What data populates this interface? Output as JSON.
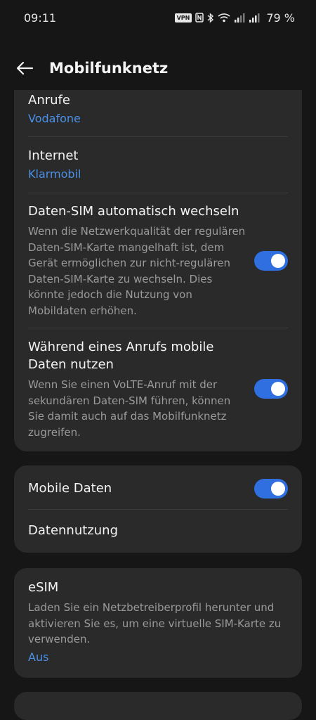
{
  "status": {
    "time": "09:11",
    "vpn": "VPN",
    "battery": "79 %"
  },
  "appbar": {
    "title": "Mobilfunknetz"
  },
  "calls": {
    "title": "Anrufe",
    "value": "Vodafone"
  },
  "internet": {
    "title": "Internet",
    "value": "Klarmobil"
  },
  "auto_switch": {
    "title": "Daten-SIM automatisch wechseln",
    "desc": "Wenn die Netzwerkqualität der regulären Daten-SIM-Karte mangelhaft ist, dem Gerät ermöglichen zur nicht-regulären Daten-SIM-Karte zu wechseln. Dies könnte jedoch die Nutzung von Mobildaten erhöhen.",
    "enabled": true
  },
  "call_data": {
    "title": "Während eines Anrufs mobile Daten nutzen",
    "desc": "Wenn Sie einen VoLTE-Anruf mit der sekundären Daten-SIM führen, können Sie damit auch auf das Mobilfunknetz zugreifen.",
    "enabled": true
  },
  "mobile_data": {
    "title": "Mobile Daten",
    "enabled": true
  },
  "data_usage": {
    "title": "Datennutzung"
  },
  "esim": {
    "title": "eSIM",
    "desc": "Laden Sie ein Netzbetreiberprofil herunter und aktivieren Sie es, um eine virtuelle SIM-Karte zu verwenden.",
    "value": "Aus"
  },
  "colors": {
    "accent": "#2f6fe0",
    "link": "#4a90e6",
    "card": "#2a2a2a",
    "background": "#161616"
  }
}
